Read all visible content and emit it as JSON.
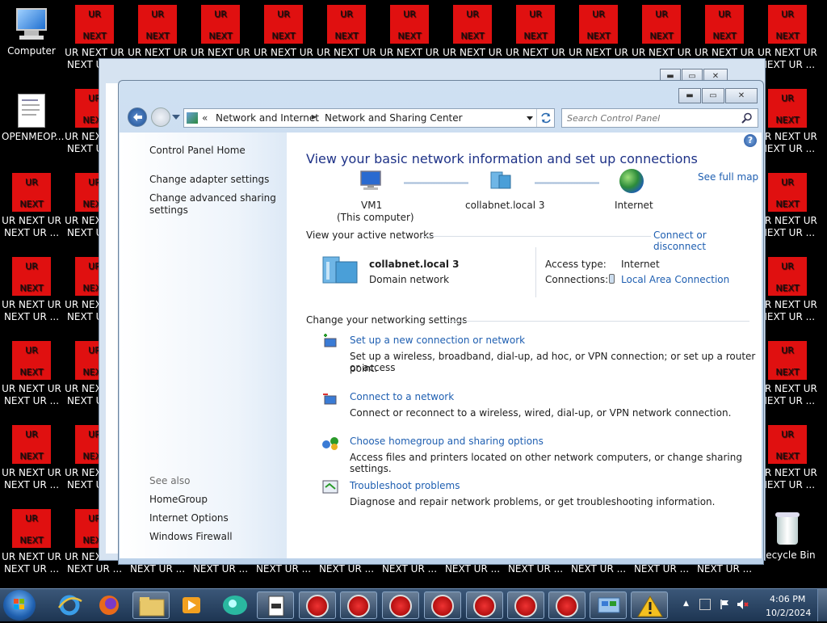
{
  "desktop": {
    "computer_label": "Computer",
    "openmeop_label": "OPENMEOP...",
    "recycle_label": "Recycle Bin",
    "ur_top": "UR",
    "ur_bottom": "NEXT",
    "ur_caption1": "UR NEXT UR",
    "ur_caption2": "NEXT UR ...",
    "ur_caption_short": "UR NEX",
    "ur_caption_short2": "NEXT U",
    "ur_top_partial": "U",
    "ur_bottom_partial": "NEX",
    "bottom_row_label": "NEXT UR ..."
  },
  "window": {
    "breadcrumb_prefix": "«",
    "breadcrumb_1": "Network and Internet",
    "breadcrumb_sep": "▶",
    "breadcrumb_2": "Network and Sharing Center",
    "search_placeholder": "Search Control Panel",
    "buttons": {
      "minimize": "▬",
      "maximize": "▭",
      "close": "✕"
    }
  },
  "left_pane": {
    "home": "Control Panel Home",
    "adapter": "Change adapter settings",
    "advanced_line1": "Change advanced sharing",
    "advanced_line2": "settings",
    "see_also": "See also",
    "homegroup": "HomeGroup",
    "internet_options": "Internet Options",
    "firewall": "Windows Firewall"
  },
  "main": {
    "title": "View your basic network information and set up connections",
    "see_full_map": "See full map",
    "map": {
      "node1_name": "VM1",
      "node1_sub": "(This computer)",
      "node2_name": "collabnet.local  3",
      "node3_name": "Internet"
    },
    "active_networks_label": "View your active networks",
    "connect_disconnect": "Connect or disconnect",
    "network_name": "collabnet.local  3",
    "network_type": "Domain network",
    "access_type_label": "Access type:",
    "access_type_value": "Internet",
    "connections_label": "Connections:",
    "connections_value": "Local Area Connection",
    "change_settings_label": "Change your networking settings",
    "tasks": [
      {
        "title": "Set up a new connection or network",
        "desc_line1": "Set up a wireless, broadband, dial-up, ad hoc, or VPN connection; or set up a router or access",
        "desc_line2": "point."
      },
      {
        "title": "Connect to a network",
        "desc_line1": "Connect or reconnect to a wireless, wired, dial-up, or VPN network connection."
      },
      {
        "title": "Choose homegroup and sharing options",
        "desc_line1": "Access files and printers located on other network computers, or change sharing settings."
      },
      {
        "title": "Troubleshoot problems",
        "desc_line1": "Diagnose and repair network problems, or get troubleshooting information."
      }
    ]
  },
  "taskbar": {
    "time": "4:06 PM",
    "date": "10/2/2024",
    "tray_arrow": "▲"
  }
}
